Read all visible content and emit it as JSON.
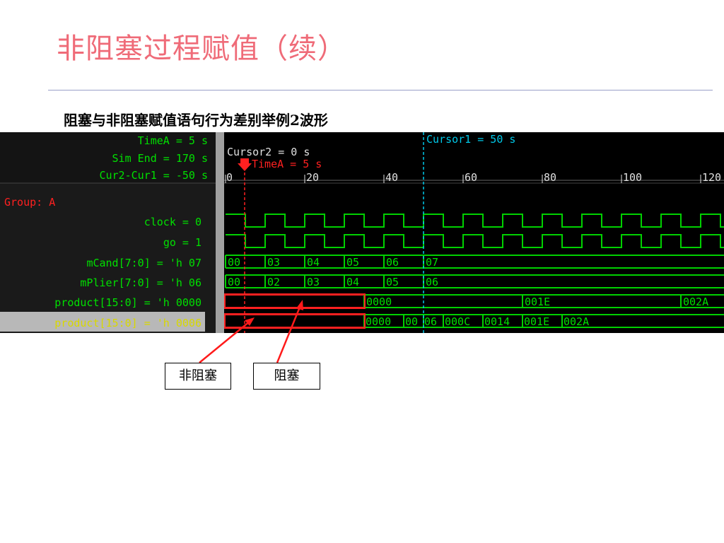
{
  "slide": {
    "title": "非阻塞过程赋值（续）",
    "subtitle": "阻塞与非阻塞赋值语句行为差别举例2波形"
  },
  "waveform": {
    "header": {
      "time_a": "TimeA = 5 s",
      "sim_end": "Sim End = 170 s",
      "cur_diff": "Cur2-Cur1 = -50 s"
    },
    "cursors": {
      "cursor2": "Cursor2 = 0 s",
      "time_a_marker": "TimeA = 5 s",
      "cursor1": "Cursor1 = 50 s"
    },
    "ticks": [
      "0",
      "20",
      "40",
      "60",
      "80",
      "100",
      "120"
    ],
    "group": "Group: A",
    "signals": [
      {
        "label": "clock = 0"
      },
      {
        "label": "go = 1"
      },
      {
        "label": "mCand[7:0] = 'h 07",
        "values": [
          "00",
          "03",
          "04",
          "05",
          "06",
          "07"
        ]
      },
      {
        "label": "mPlier[7:0] = 'h 06",
        "values": [
          "00",
          "02",
          "03",
          "04",
          "05",
          "06"
        ]
      },
      {
        "label": "product[15:0] = 'h 0000",
        "values": [
          "0000",
          "001E",
          "002A"
        ]
      },
      {
        "label": "product[15:0] = 'h 0006",
        "values": [
          "0000",
          "00",
          "06",
          "000C",
          "0014",
          "001E",
          "002A"
        ]
      }
    ],
    "colors": {
      "background": "#000000",
      "panel": "#1a1a1a",
      "trace": "#00d000",
      "text_green": "#00e000",
      "group_red": "#ff2020",
      "cursor_red": "#ff2020",
      "cursor_cyan": "#00c8e8",
      "highlight_box": "#ff2020"
    }
  },
  "labels": {
    "nonblocking": "非阻塞",
    "blocking": "阻塞"
  }
}
